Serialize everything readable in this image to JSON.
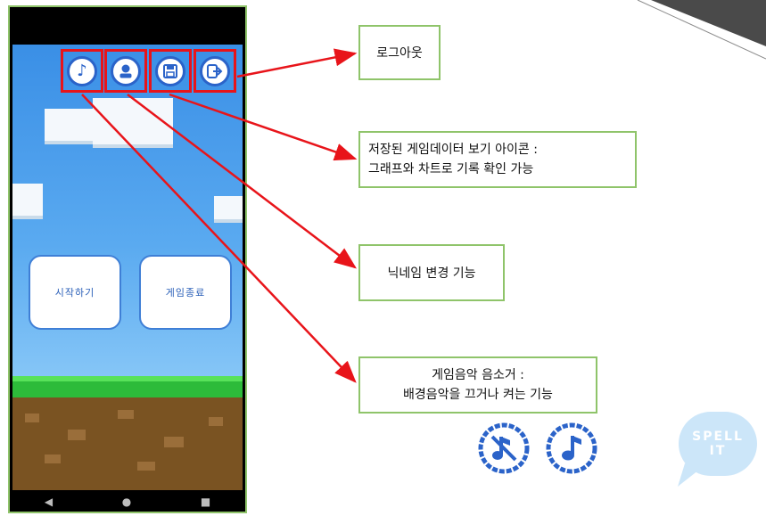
{
  "game": {
    "start_label": "시작하기",
    "quit_label": "게임종료"
  },
  "nav": {
    "back": "◀",
    "home": "●",
    "recent": "■"
  },
  "callouts": {
    "logout": "로그아웃",
    "data_line1": "저장된 게임데이터 보기 아이콘 :",
    "data_line2": "그래프와 차트로 기록 확인 가능",
    "nickname": "닉네임 변경 기능",
    "music_line1": "게임음악 음소거 :",
    "music_line2": "배경음악을 끄거나 켜는 기능"
  },
  "logo": {
    "line1": "SPELL",
    "line2": "IT"
  },
  "icons": {
    "music": "music-note-icon",
    "profile": "profile-icon",
    "save": "save-disk-icon",
    "logout": "logout-icon",
    "music_off": "music-off-icon",
    "music_on": "music-on-icon"
  },
  "colors": {
    "highlight": "#e8141a",
    "frame": "#8fc46a",
    "icon_blue": "#2b63c9"
  }
}
